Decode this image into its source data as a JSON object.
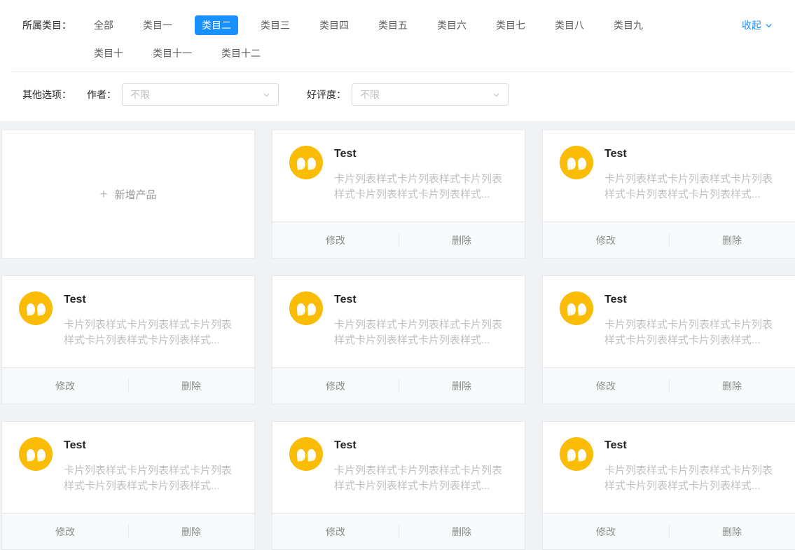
{
  "colors": {
    "accent_blue": "#1890ff",
    "avatar_gold": "#fbbc05",
    "page_background": "#f0f2f5"
  },
  "icons": {
    "add": "+",
    "avatar_quote": "”",
    "chevron": "v"
  },
  "category_filter": {
    "label": "所属类目：",
    "options": [
      "全部",
      "类目一",
      "类目二",
      "类目三",
      "类目四",
      "类目五",
      "类目六",
      "类目七",
      "类目八",
      "类目九",
      "类目十",
      "类目十一",
      "类目十二"
    ],
    "selected_index": 2,
    "collapse_label": "收起"
  },
  "other_filter": {
    "label": "其他选项：",
    "author": {
      "label": "作者：",
      "value": "不限"
    },
    "rating": {
      "label": "好评度：",
      "value": "不限"
    }
  },
  "card_list": {
    "add_card_label": "新增产品",
    "items": [
      {
        "title": "Test",
        "description": "卡片列表样式卡片列表样式卡片列表样式卡片列表样式卡片列表样式...",
        "actions": {
          "modify": "修改",
          "delete": "删除"
        }
      },
      {
        "title": "Test",
        "description": "卡片列表样式卡片列表样式卡片列表样式卡片列表样式卡片列表样式...",
        "actions": {
          "modify": "修改",
          "delete": "删除"
        }
      },
      {
        "title": "Test",
        "description": "卡片列表样式卡片列表样式卡片列表样式卡片列表样式卡片列表样式...",
        "actions": {
          "modify": "修改",
          "delete": "删除"
        }
      },
      {
        "title": "Test",
        "description": "卡片列表样式卡片列表样式卡片列表样式卡片列表样式卡片列表样式...",
        "actions": {
          "modify": "修改",
          "delete": "删除"
        }
      },
      {
        "title": "Test",
        "description": "卡片列表样式卡片列表样式卡片列表样式卡片列表样式卡片列表样式...",
        "actions": {
          "modify": "修改",
          "delete": "删除"
        }
      },
      {
        "title": "Test",
        "description": "卡片列表样式卡片列表样式卡片列表样式卡片列表样式卡片列表样式...",
        "actions": {
          "modify": "修改",
          "delete": "删除"
        }
      },
      {
        "title": "Test",
        "description": "卡片列表样式卡片列表样式卡片列表样式卡片列表样式卡片列表样式...",
        "actions": {
          "modify": "修改",
          "delete": "删除"
        }
      },
      {
        "title": "Test",
        "description": "卡片列表样式卡片列表样式卡片列表样式卡片列表样式卡片列表样式...",
        "actions": {
          "modify": "修改",
          "delete": "删除"
        }
      }
    ]
  }
}
